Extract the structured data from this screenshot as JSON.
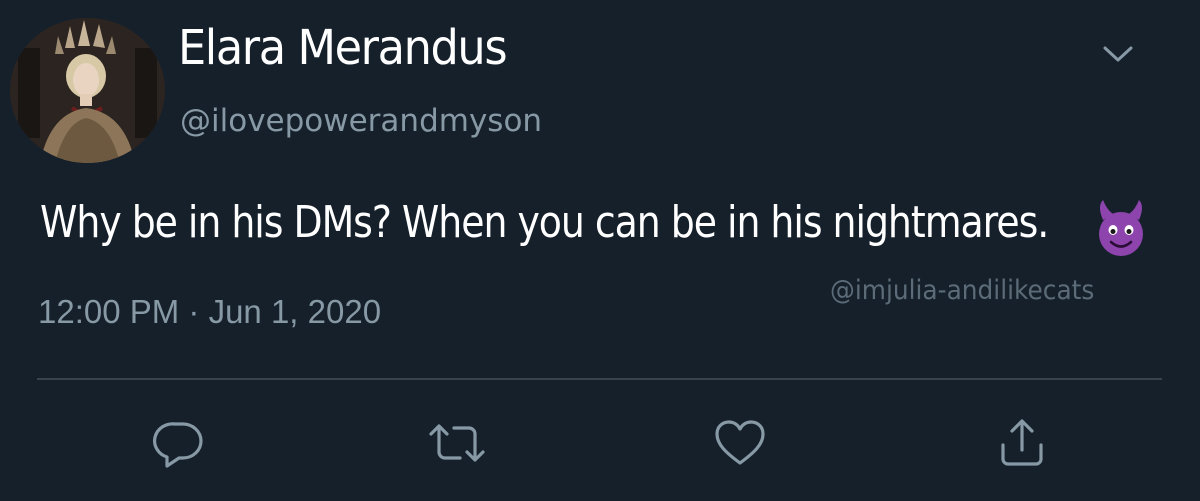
{
  "tweet": {
    "display_name": "Elara Merandus",
    "handle": "@ilovepowerandmyson",
    "text": "Why be in his DMs? When you can be in his nightmares.",
    "emoji": "smiling-face-with-horns",
    "timestamp": "12:00 PM · Jun 1, 2020",
    "watermark": "@imjulia-andilikecats"
  },
  "actions": [
    {
      "name": "reply",
      "icon": "reply-icon"
    },
    {
      "name": "retweet",
      "icon": "retweet-icon"
    },
    {
      "name": "like",
      "icon": "heart-icon"
    },
    {
      "name": "share",
      "icon": "share-icon"
    }
  ],
  "colors": {
    "background": "#15202b",
    "text_primary": "#ffffff",
    "text_secondary": "#8899a6",
    "divider": "#38444d",
    "icon": "#8899a6",
    "emoji_purple": "#8e44ad"
  }
}
